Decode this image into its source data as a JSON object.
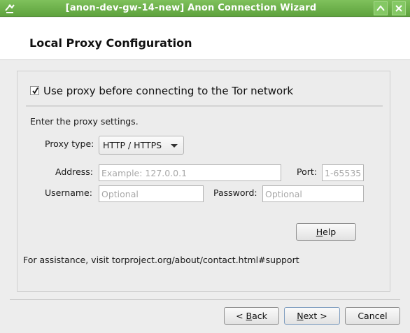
{
  "window": {
    "title": "[anon-dev-gw-14-new] Anon Connection Wizard",
    "accent_color": "#6db34a",
    "icons": [
      "app-icon",
      "maximize-icon",
      "close-icon"
    ]
  },
  "header": {
    "title": "Local Proxy Configuration"
  },
  "proxy": {
    "use_proxy_checked": true,
    "use_proxy_label": "Use proxy before connecting to the Tor network",
    "instruction": "Enter the proxy settings.",
    "type_label": "Proxy type:",
    "type_value": "HTTP / HTTPS",
    "address_label": "Address:",
    "address_placeholder": "Example: 127.0.0.1",
    "address_value": "",
    "port_label": "Port:",
    "port_placeholder": "1-65535",
    "port_value": "",
    "username_label": "Username:",
    "username_placeholder": "Optional",
    "username_value": "",
    "password_label": "Password:",
    "password_placeholder": "Optional",
    "password_value": "",
    "help_pre": "",
    "help_u": "H",
    "help_post": "elp",
    "assistance": "For assistance, visit torproject.org/about/contact.html#support"
  },
  "footer": {
    "back_pre": "< ",
    "back_u": "B",
    "back_post": "ack",
    "next_u": "N",
    "next_post": "ext >",
    "cancel_label": "Cancel"
  }
}
